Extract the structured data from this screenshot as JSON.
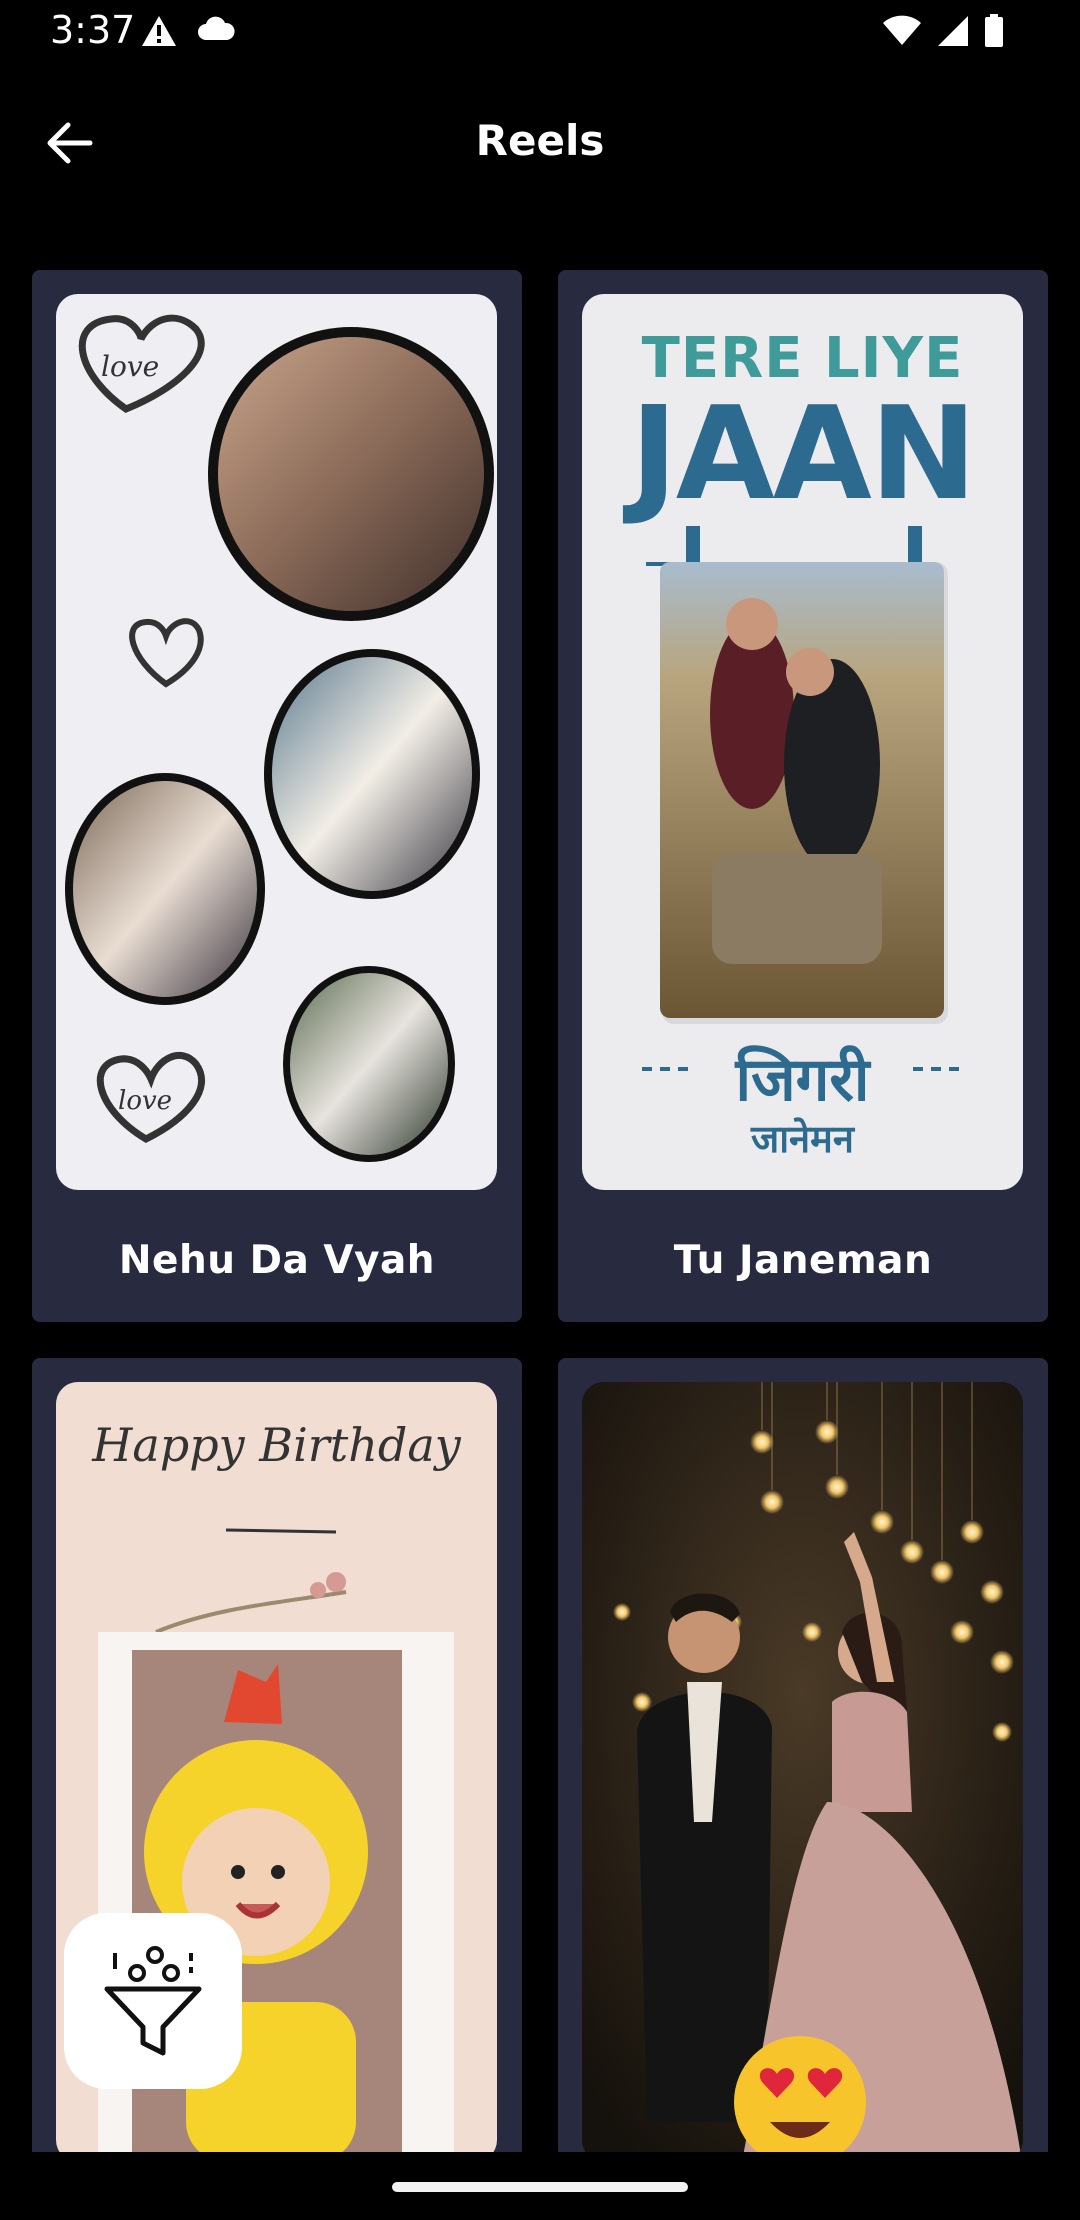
{
  "status_bar": {
    "time": "3:37",
    "left_icons": [
      "warning-icon",
      "cloud-icon"
    ],
    "right_icons": [
      "wifi-icon",
      "signal-icon",
      "battery-icon"
    ]
  },
  "app_bar": {
    "back_icon": "arrow-left-icon",
    "title": "Reels"
  },
  "cards": [
    {
      "label": "Nehu Da Vyah"
    },
    {
      "label": "Tu Janeman",
      "poster": {
        "line1": "TERE LIYE",
        "line2": "JAAN",
        "hindi1": "जिगरी",
        "hindi2": "जानेमन"
      }
    },
    {
      "label": "",
      "poster": {
        "script": "Happy Birthday"
      }
    },
    {
      "label": ""
    }
  ],
  "fab": {
    "icon": "filter-icon"
  },
  "colors": {
    "background": "#000000",
    "card": "#282b3f",
    "text": "#ffffff",
    "poster_blue": "#2d6a8f",
    "poster_teal": "#3f9a9a"
  }
}
